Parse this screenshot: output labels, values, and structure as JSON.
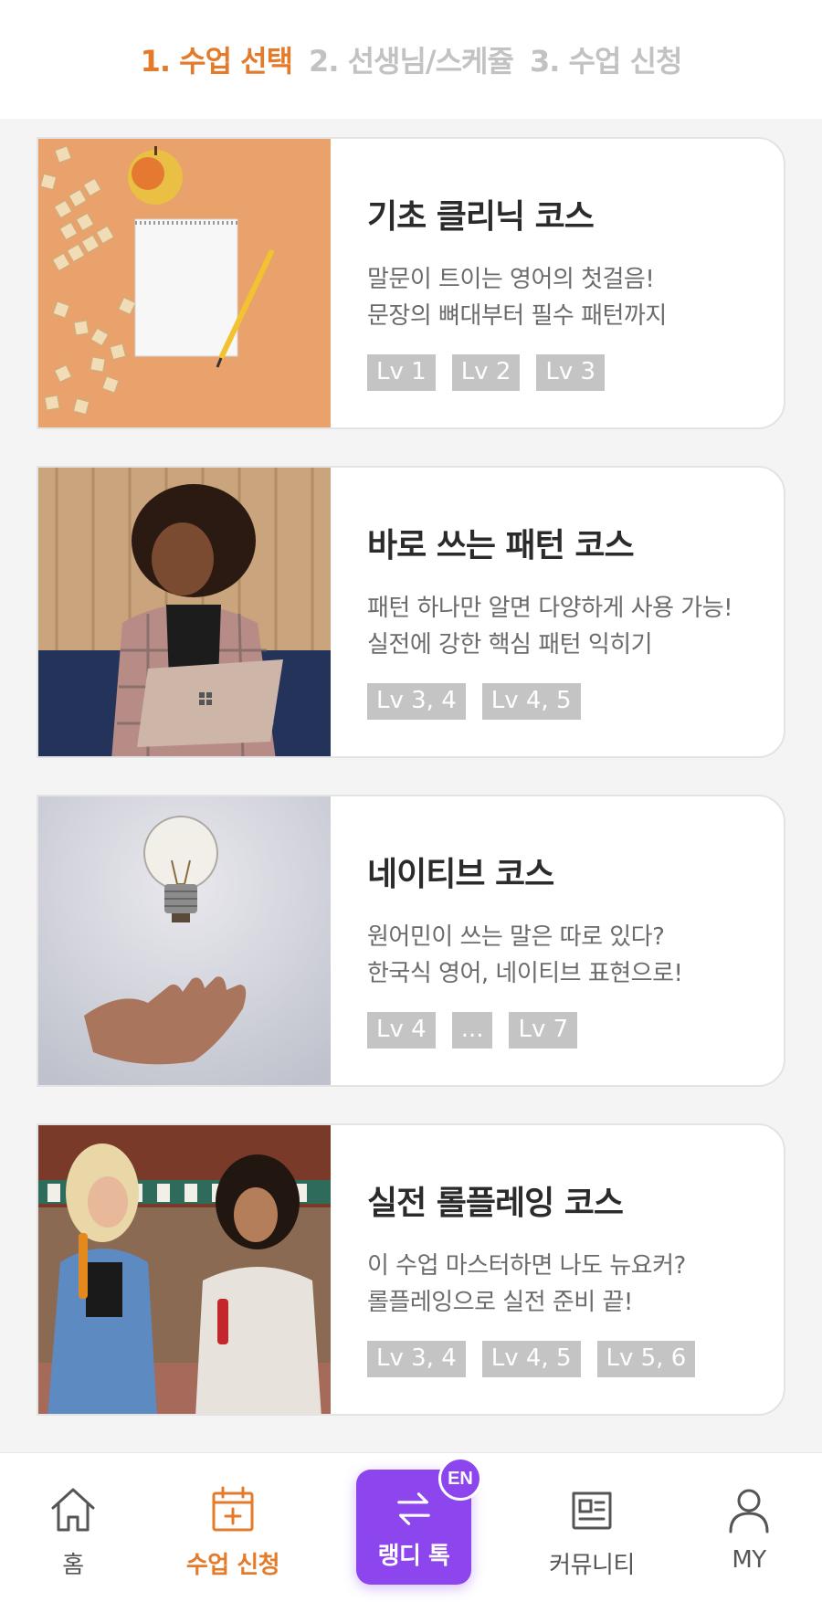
{
  "steps": [
    {
      "label": "1. 수업 선택",
      "active": true
    },
    {
      "label": "2. 선생님/스케쥴",
      "active": false
    },
    {
      "label": "3. 수업 신청",
      "active": false
    }
  ],
  "courses": [
    {
      "title": "기초 클리닉 코스",
      "desc_line1": "말문이 트이는 영어의 첫걸음!",
      "desc_line2": "문장의 뼈대부터 필수 패턴까지",
      "levels": [
        "Lv 1",
        "Lv 2",
        "Lv 3"
      ],
      "image": "notebook-and-apple-photo"
    },
    {
      "title": "바로 쓰는 패턴 코스",
      "desc_line1": "패턴 하나만 알면 다양하게 사용 가능!",
      "desc_line2": "실전에 강한 핵심 패턴 익히기",
      "levels": [
        "Lv 3, 4",
        "Lv 4, 5"
      ],
      "image": "woman-with-laptop-photo"
    },
    {
      "title": "네이티브 코스",
      "desc_line1": "원어민이 쓰는 말은 따로 있다?",
      "desc_line2": "한국식 영어, 네이티브 표현으로!",
      "levels": [
        "Lv 4",
        "...",
        "Lv 7"
      ],
      "image": "lightbulb-over-hand-photo"
    },
    {
      "title": "실전 롤플레잉 코스",
      "desc_line1": "이 수업 마스터하면 나도 뉴요커?",
      "desc_line2": "롤플레잉으로 실전 준비 끝!",
      "levels": [
        "Lv 3, 4",
        "Lv 4, 5",
        "Lv 5, 6"
      ],
      "image": "two-women-laughing-photo"
    }
  ],
  "nav": {
    "home": "홈",
    "apply": "수업 신청",
    "talk": "랭디 톡",
    "talk_badge": "EN",
    "community": "커뮤니티",
    "my": "MY"
  },
  "colors": {
    "accent_orange": "#e47b2a",
    "accent_purple": "#8d45ee",
    "inactive_step": "#c2c2c2",
    "level_chip": "#c4c4c4"
  }
}
